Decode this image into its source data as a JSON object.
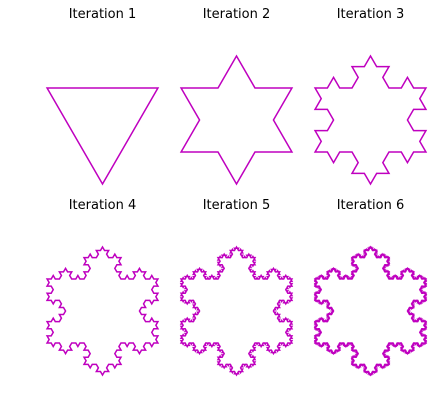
{
  "figure": {
    "line_color": "#bf00bf",
    "background": "#ffffff",
    "panels": [
      {
        "title": "Iteration 1",
        "iteration": 1
      },
      {
        "title": "Iteration 2",
        "iteration": 2
      },
      {
        "title": "Iteration 3",
        "iteration": 3
      },
      {
        "title": "Iteration 4",
        "iteration": 4
      },
      {
        "title": "Iteration 5",
        "iteration": 5
      },
      {
        "title": "Iteration 6",
        "iteration": 6
      }
    ]
  }
}
